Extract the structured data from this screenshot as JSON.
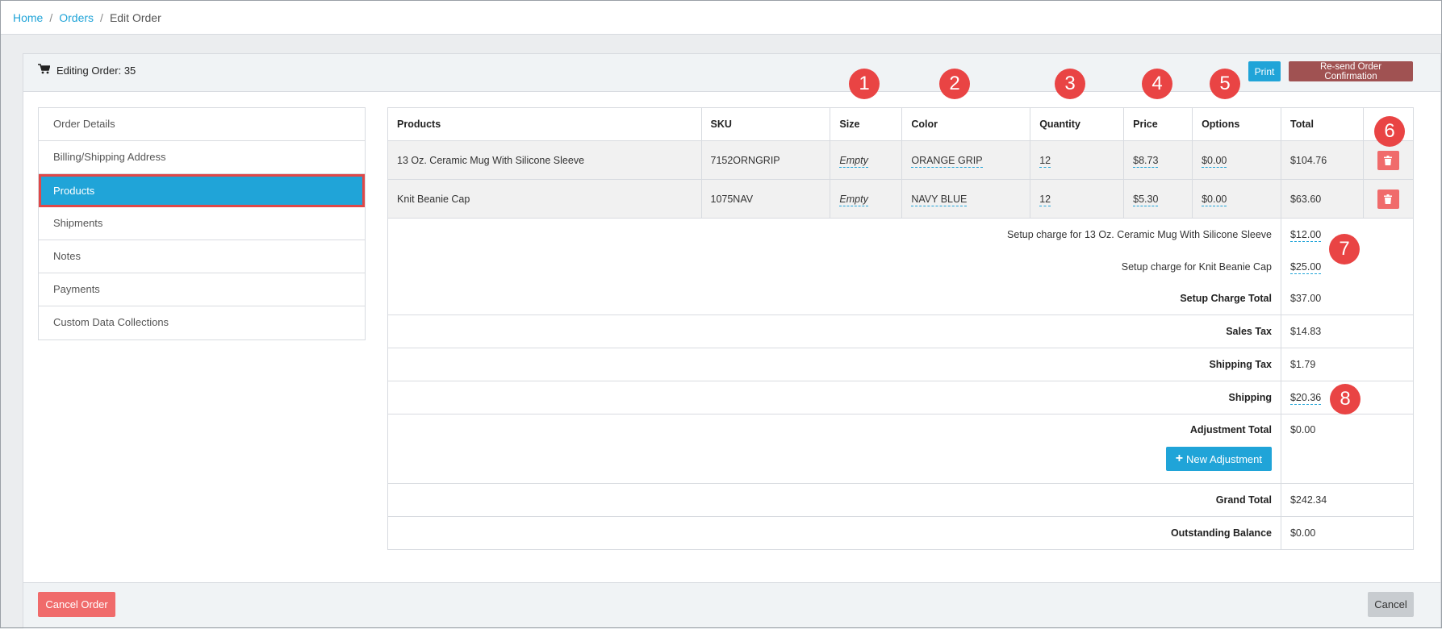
{
  "breadcrumb": {
    "home": "Home",
    "orders": "Orders",
    "current": "Edit Order",
    "sep": "/"
  },
  "header": {
    "title": "Editing Order: 35",
    "print_label": "Print",
    "resend_label": "Re-send Order Confirmation"
  },
  "sidebar": {
    "items": [
      {
        "label": "Order Details"
      },
      {
        "label": "Billing/Shipping Address"
      },
      {
        "label": "Products"
      },
      {
        "label": "Shipments"
      },
      {
        "label": "Notes"
      },
      {
        "label": "Payments"
      },
      {
        "label": "Custom Data Collections"
      }
    ],
    "active_index": 2
  },
  "table": {
    "columns": [
      "Products",
      "SKU",
      "Size",
      "Color",
      "Quantity",
      "Price",
      "Options",
      "Total"
    ],
    "rows": [
      {
        "product": "13 Oz. Ceramic Mug With Silicone Sleeve",
        "sku": "7152ORNGRIP",
        "size": "Empty",
        "color": "ORANGE GRIP",
        "quantity": "12",
        "price": "$8.73",
        "options": "$0.00",
        "total": "$104.76"
      },
      {
        "product": "Knit Beanie Cap",
        "sku": "1075NAV",
        "size": "Empty",
        "color": "NAVY BLUE",
        "quantity": "12",
        "price": "$5.30",
        "options": "$0.00",
        "total": "$63.60"
      }
    ]
  },
  "summary": {
    "setup_charges": [
      {
        "label": "Setup charge for 13 Oz. Ceramic Mug With Silicone Sleeve",
        "value": "$12.00"
      },
      {
        "label": "Setup charge for Knit Beanie Cap",
        "value": "$25.00"
      }
    ],
    "setup_total": {
      "label": "Setup Charge Total",
      "value": "$37.00"
    },
    "sales_tax": {
      "label": "Sales Tax",
      "value": "$14.83"
    },
    "shipping_tax": {
      "label": "Shipping Tax",
      "value": "$1.79"
    },
    "shipping": {
      "label": "Shipping",
      "value": "$20.36"
    },
    "adjustment_total": {
      "label": "Adjustment Total",
      "value": "$0.00"
    },
    "new_adjustment_label": "New Adjustment",
    "grand_total": {
      "label": "Grand Total",
      "value": "$242.34"
    },
    "outstanding_balance": {
      "label": "Outstanding Balance",
      "value": "$0.00"
    }
  },
  "footer": {
    "cancel_order_label": "Cancel Order",
    "cancel_label": "Cancel"
  },
  "markers": [
    "1",
    "2",
    "3",
    "4",
    "5",
    "6",
    "7",
    "8"
  ],
  "colors": {
    "accent": "#20a4d8",
    "danger": "#f06b6b",
    "resend": "#a05252",
    "marker": "#e94444"
  }
}
